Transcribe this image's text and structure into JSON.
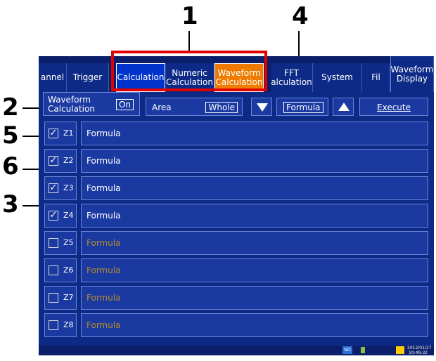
{
  "callouts": [
    "1",
    "2",
    "3",
    "4",
    "5",
    "6"
  ],
  "tabs": {
    "channel": "annel",
    "trigger": "Trigger",
    "calculation": "Calculation",
    "numeric": "Numeric Calculation",
    "waveform": "Waveform Calculation",
    "fft": "FFT alculation",
    "system": "System",
    "file": "Fil",
    "waveform_display": "Waveform Display"
  },
  "controls": {
    "waveform_calc_label": "Waveform Calculation",
    "waveform_calc_value": "On",
    "area_label": "Area",
    "area_value": "Whole",
    "formula_button": "Formula",
    "execute_button": "Execute"
  },
  "rows": [
    {
      "label": "Z1",
      "checked": true,
      "formula": "Formula"
    },
    {
      "label": "Z2",
      "checked": true,
      "formula": "Formula"
    },
    {
      "label": "Z3",
      "checked": true,
      "formula": "Formula"
    },
    {
      "label": "Z4",
      "checked": true,
      "formula": "Formula"
    },
    {
      "label": "Z5",
      "checked": false,
      "formula": "Formula"
    },
    {
      "label": "Z6",
      "checked": false,
      "formula": "Formula"
    },
    {
      "label": "Z7",
      "checked": false,
      "formula": "Formula"
    },
    {
      "label": "Z8",
      "checked": false,
      "formula": "Formula"
    }
  ],
  "status": {
    "sd": "SD",
    "datetime_line1": "2012/01/27",
    "datetime_line2": "10:49:32"
  },
  "colors": {
    "bg": "#0d2a86",
    "selected_tab": "#ef7b00",
    "highlight_box": "#e00000",
    "formula_disabled": "#b58a2a"
  }
}
